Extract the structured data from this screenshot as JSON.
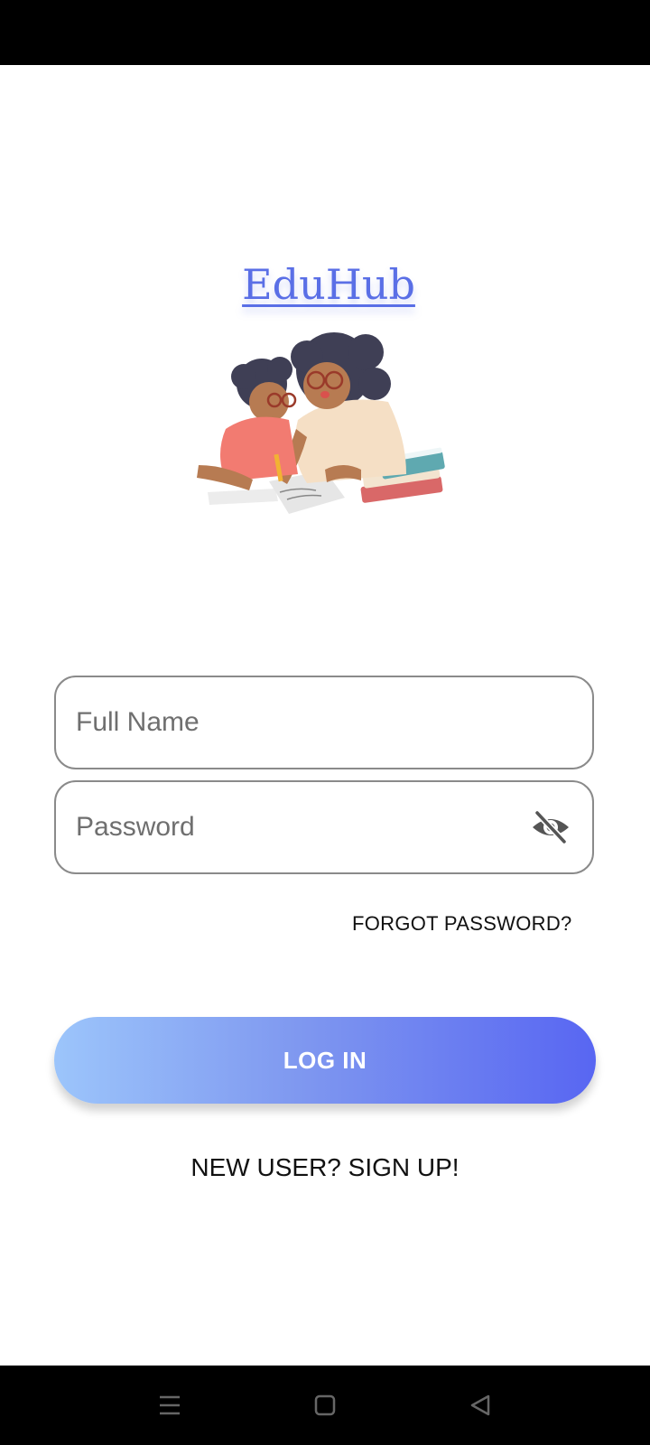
{
  "app": {
    "title": "EduHub"
  },
  "form": {
    "full_name_placeholder": "Full Name",
    "password_placeholder": "Password",
    "forgot_password": "FORGOT PASSWORD?",
    "login_label": "LOG IN",
    "signup_label": "NEW USER? SIGN UP!"
  },
  "colors": {
    "accent": "#5a6fe6",
    "button_gradient_start": "#9cc5fb",
    "button_gradient_end": "#5866f2",
    "field_border": "#8a8a8a"
  },
  "icons": {
    "password_toggle": "eye-off-icon",
    "nav_menu": "menu-icon",
    "nav_home": "home-square-icon",
    "nav_back": "back-triangle-icon"
  }
}
